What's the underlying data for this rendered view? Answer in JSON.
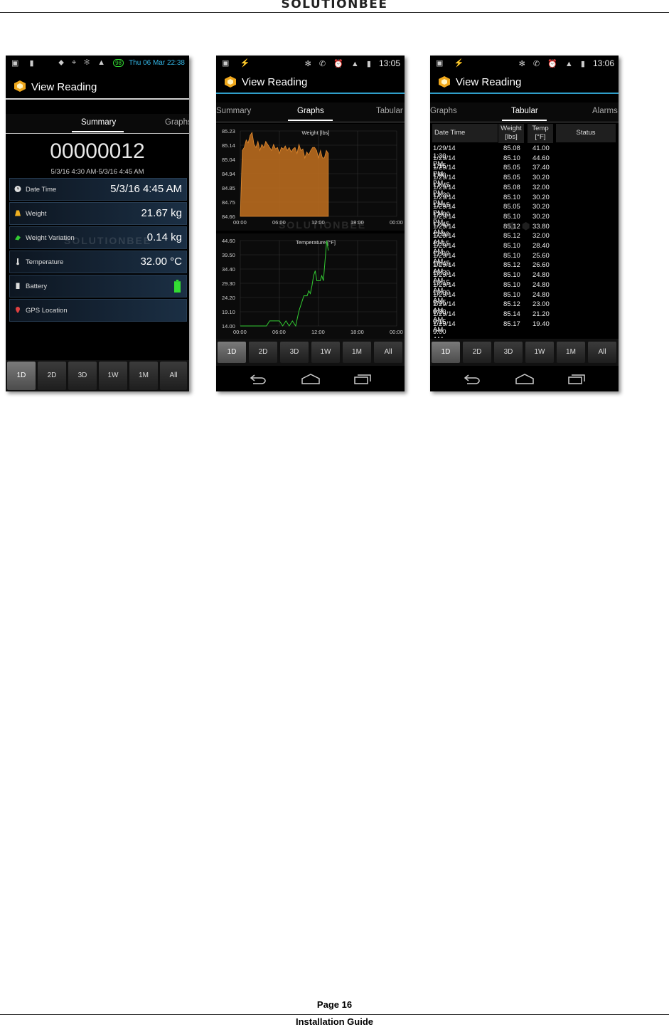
{
  "document": {
    "brand": "SOLUTIONBEE",
    "page_label": "Page 16",
    "guide_label": "Installation Guide"
  },
  "common": {
    "app_title": "View Reading",
    "ranges": [
      "1D",
      "2D",
      "3D",
      "1W",
      "1M",
      "All"
    ],
    "selected_range": "1D"
  },
  "phone1": {
    "status": {
      "clock": "Thu 06 Mar 22:38",
      "battery_badge": "98"
    },
    "tabs": [
      "Summary",
      "Graphs"
    ],
    "active_tab": "Summary",
    "identifier": "00000012",
    "range": "5/3/16 4:30 AM-5/3/16 4:45 AM",
    "rows": [
      {
        "icon": "clock-icon",
        "label": "Date Time",
        "value": "5/3/16 4:45 AM"
      },
      {
        "icon": "weight-icon",
        "label": "Weight",
        "value": "21.67 kg"
      },
      {
        "icon": "weight-variation-icon",
        "label": "Weight Variation",
        "value": "0.14 kg"
      },
      {
        "icon": "thermometer-icon",
        "label": "Temperature",
        "value": "32.00 °C"
      },
      {
        "icon": "battery-icon",
        "label": "Battery",
        "value": ""
      },
      {
        "icon": "map-pin-icon",
        "label": "GPS Location",
        "value": ""
      }
    ],
    "battery_color": "#33dd33",
    "watermark": "SOLUTIONBEE"
  },
  "phone2": {
    "status": {
      "clock": "13:05"
    },
    "tabs": [
      "Summary",
      "Graphs",
      "Tabular"
    ],
    "active_tab": "Graphs",
    "watermark": "SOLUTIONBEE"
  },
  "phone3": {
    "status": {
      "clock": "13:06"
    },
    "tabs": [
      "Graphs",
      "Tabular",
      "Alarms"
    ],
    "active_tab": "Tabular",
    "table": {
      "headers": [
        "Date Time",
        "Weight [lbs]",
        "Temp [°F]",
        "Status"
      ],
      "rows": [
        [
          "1/29/14 1:30 PM",
          "85.08",
          "41.00"
        ],
        [
          "1/29/14 1:15 PM",
          "85.10",
          "44.60"
        ],
        [
          "1/29/14 1:00 PM",
          "85.05",
          "37.40"
        ],
        [
          "1/29/14 12:45 PM",
          "85.05",
          "30.20"
        ],
        [
          "1/29/14 12:30 PM",
          "85.08",
          "32.00"
        ],
        [
          "1/29/14 12:15 PM",
          "85.10",
          "30.20"
        ],
        [
          "1/29/14 12:00 PM",
          "85.05",
          "30.20"
        ],
        [
          "1/29/14 11:45 AM",
          "85.10",
          "30.20"
        ],
        [
          "1/29/14 11:30 AM",
          "85.12",
          "33.80"
        ],
        [
          "1/29/14 11:15 AM",
          "85.12",
          "32.00"
        ],
        [
          "1/29/14 11:00 AM",
          "85.10",
          "28.40"
        ],
        [
          "1/29/14 10:45 AM",
          "85.10",
          "25.60"
        ],
        [
          "1/29/14 10:30 AM",
          "85.12",
          "26.60"
        ],
        [
          "1/29/14 10:15 AM",
          "85.10",
          "24.80"
        ],
        [
          "1/29/14 10:00 AM",
          "85.10",
          "24.80"
        ],
        [
          "1/29/14 9:45 AM",
          "85.10",
          "24.80"
        ],
        [
          "1/29/14 9:30 AM",
          "85.12",
          "23.00"
        ],
        [
          "1/29/14 9:15 AM",
          "85.14",
          "21.20"
        ],
        [
          "1/29/14 9:00 AM",
          "85.17",
          "19.40"
        ]
      ]
    }
  },
  "chart_data": [
    {
      "type": "area",
      "title": "Weight [lbs]",
      "x_tick_labels": [
        "00:00",
        "06:00",
        "12:00",
        "18:00",
        "00:00"
      ],
      "y_tick_labels": [
        "85.23",
        "85.14",
        "85.04",
        "84.94",
        "84.85",
        "84.75",
        "84.66"
      ],
      "xlim": [
        0,
        24
      ],
      "ylim": [
        84.66,
        85.23
      ],
      "grid": true,
      "color": "#b86a1e",
      "x": [
        0,
        0.3,
        0.6,
        0.9,
        1.2,
        1.5,
        1.8,
        2.1,
        2.4,
        2.7,
        3.0,
        3.3,
        3.6,
        3.9,
        4.2,
        4.5,
        4.8,
        5.1,
        5.4,
        5.7,
        6.0,
        6.3,
        6.6,
        6.9,
        7.2,
        7.5,
        7.8,
        8.1,
        8.4,
        8.7,
        9.0,
        9.3,
        9.6,
        9.9,
        10.2,
        10.5,
        10.8,
        11.1,
        11.4,
        11.7,
        12.0,
        12.3,
        12.6,
        12.9,
        13.2,
        13.5
      ],
      "y": [
        84.66,
        85.1,
        85.12,
        85.17,
        85.15,
        85.2,
        85.22,
        85.14,
        85.12,
        85.16,
        85.1,
        85.14,
        85.12,
        85.16,
        85.14,
        85.12,
        85.1,
        85.14,
        85.11,
        85.12,
        85.08,
        85.12,
        85.11,
        85.13,
        85.1,
        85.12,
        85.09,
        85.11,
        85.12,
        85.08,
        85.14,
        85.1,
        85.11,
        85.05,
        85.09,
        85.07,
        85.1,
        85.12,
        85.12,
        85.1,
        85.05,
        85.1,
        85.05,
        85.05,
        85.1,
        85.08
      ]
    },
    {
      "type": "line",
      "title": "Temperature [°F]",
      "x_tick_labels": [
        "00:00",
        "06:00",
        "12:00",
        "18:00",
        "00:00"
      ],
      "y_tick_labels": [
        "44.60",
        "39.50",
        "34.40",
        "29.30",
        "24.20",
        "19.10",
        "14.00"
      ],
      "xlim": [
        0,
        24
      ],
      "ylim": [
        14.0,
        44.6
      ],
      "grid": true,
      "color": "#33cc33",
      "x": [
        0,
        2.0,
        4.0,
        4.5,
        5.0,
        5.5,
        6.0,
        6.5,
        7.0,
        7.5,
        8.0,
        8.5,
        9.0,
        9.25,
        9.5,
        9.75,
        10.0,
        10.25,
        10.5,
        10.75,
        11.0,
        11.25,
        11.5,
        11.75,
        12.0,
        12.25,
        12.5,
        12.75,
        13.0,
        13.25,
        13.5
      ],
      "y": [
        14.0,
        14.0,
        14.0,
        15.8,
        15.8,
        15.8,
        15.8,
        14.0,
        15.8,
        14.0,
        15.8,
        14.0,
        19.4,
        21.2,
        23.0,
        24.8,
        24.8,
        24.8,
        26.6,
        25.6,
        28.4,
        32.0,
        33.8,
        30.2,
        30.2,
        30.2,
        32.0,
        30.2,
        37.4,
        44.6,
        41.0
      ]
    }
  ]
}
